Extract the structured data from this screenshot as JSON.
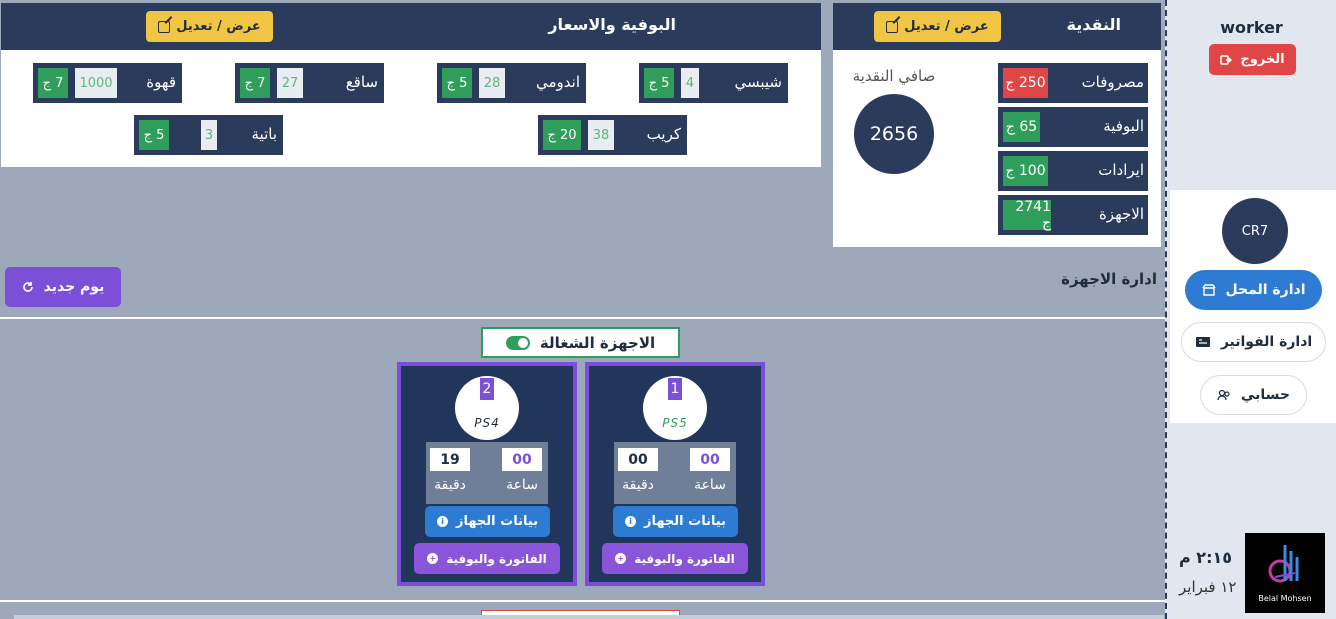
{
  "cash": {
    "title": "النقدية",
    "edit_label": "عرض / تعديل",
    "rows": [
      {
        "label": "مصروفات",
        "value": "250 ج",
        "color": "#e04646"
      },
      {
        "label": "البوفية",
        "value": "65 ج",
        "color": "#2f9e5b"
      },
      {
        "label": "ايرادات",
        "value": "100 ج",
        "color": "#2f9e5b"
      },
      {
        "label": "الاجهزة",
        "value": "2741 ج",
        "color": "#2f9e5b"
      }
    ],
    "net_label": "صافي النقدية",
    "net_value": "2656"
  },
  "buffet": {
    "title": "البوفية والاسعار",
    "edit_label": "عرض / تعديل",
    "items": [
      {
        "name": "شيبسي",
        "qty": "4",
        "price": "5 ج"
      },
      {
        "name": "اندومي",
        "qty": "28",
        "price": "5 ج"
      },
      {
        "name": "ساقع",
        "qty": "27",
        "price": "7 ج"
      },
      {
        "name": "قهوة",
        "qty": "1000",
        "price": "7 ج"
      },
      {
        "name": "كريب",
        "qty": "38",
        "price": "20 ج"
      },
      {
        "name": "باتية",
        "qty": "3",
        "price": "5 ج"
      }
    ]
  },
  "devices_section": {
    "title": "ادارة الاجهزة",
    "new_day_label": "يوم جديد",
    "running_label": "الاجهزة الشغالة"
  },
  "devices": [
    {
      "number": "1",
      "model": "PS5",
      "hours": "00",
      "minutes": "00",
      "hour_label": "ساعة",
      "minute_label": "دقيقة",
      "info_label": "بيانات الجهاز",
      "bill_label": "الفاتورة والبوفية"
    },
    {
      "number": "2",
      "model": "PS4",
      "hours": "00",
      "minutes": "19",
      "hour_label": "ساعة",
      "minute_label": "دقيقة",
      "info_label": "بيانات الجهاز",
      "bill_label": "الفاتورة والبوفية"
    }
  ],
  "sidebar": {
    "user": "worker",
    "logout_label": "الخروج",
    "avatar_text": "CR7",
    "nav": [
      {
        "label": "ادارة المحل",
        "icon": "store-icon"
      },
      {
        "label": "ادارة الفواتير",
        "icon": "invoice-icon"
      },
      {
        "label": "حسابي",
        "icon": "users-icon"
      }
    ],
    "time": "٢:١٥ م",
    "date": "١٢ فبراير",
    "brand": "Belal Mohsen"
  }
}
